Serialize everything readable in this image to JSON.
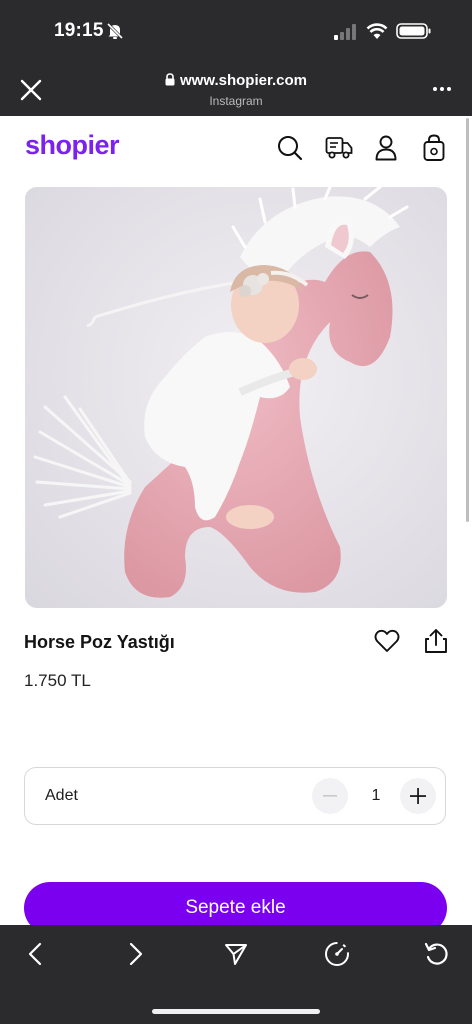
{
  "status_bar": {
    "time": "19:15"
  },
  "browser": {
    "url": "www.shopier.com",
    "source": "Instagram"
  },
  "site": {
    "logo": "shopier"
  },
  "product": {
    "title": "Horse Poz Yastığı",
    "price": "1.750 TL"
  },
  "quantity": {
    "label": "Adet",
    "value": "1"
  },
  "cart_button": {
    "label": "Sepete ekle"
  },
  "colors": {
    "brand": "#7b22ef",
    "cta": "#7b00f0",
    "chrome": "#2b2b2d"
  }
}
